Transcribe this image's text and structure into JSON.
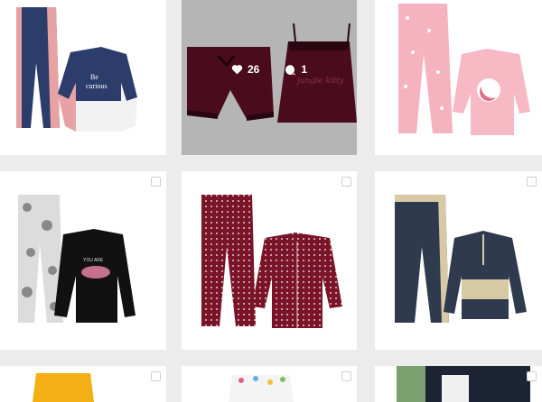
{
  "grid": {
    "posts": [
      {
        "id": "p1",
        "alt": "blue and pink kids pajama set with 'Be curious' sweatshirt"
      },
      {
        "id": "p2",
        "alt": "burgundy velvet cami and shorts set",
        "likes": "26",
        "comments": "1",
        "hovered": true
      },
      {
        "id": "p3",
        "alt": "pink pajama set with moon print"
      },
      {
        "id": "p4",
        "alt": "floral pants and black long sleeve top set"
      },
      {
        "id": "p5",
        "alt": "burgundy polka dot button-up pajama set"
      },
      {
        "id": "p6",
        "alt": "navy and beige track pajama set"
      },
      {
        "id": "p7",
        "alt": "yellow shorts set"
      },
      {
        "id": "p8",
        "alt": "white set with colorful dots"
      },
      {
        "id": "p9",
        "alt": "dark set with white details"
      }
    ]
  },
  "colors": {
    "background": "#ececec",
    "overlay": "#b5b5b5",
    "burgundy": "#5a0f22",
    "navy": "#2c3d6b",
    "pink": "#e7a2a4"
  }
}
